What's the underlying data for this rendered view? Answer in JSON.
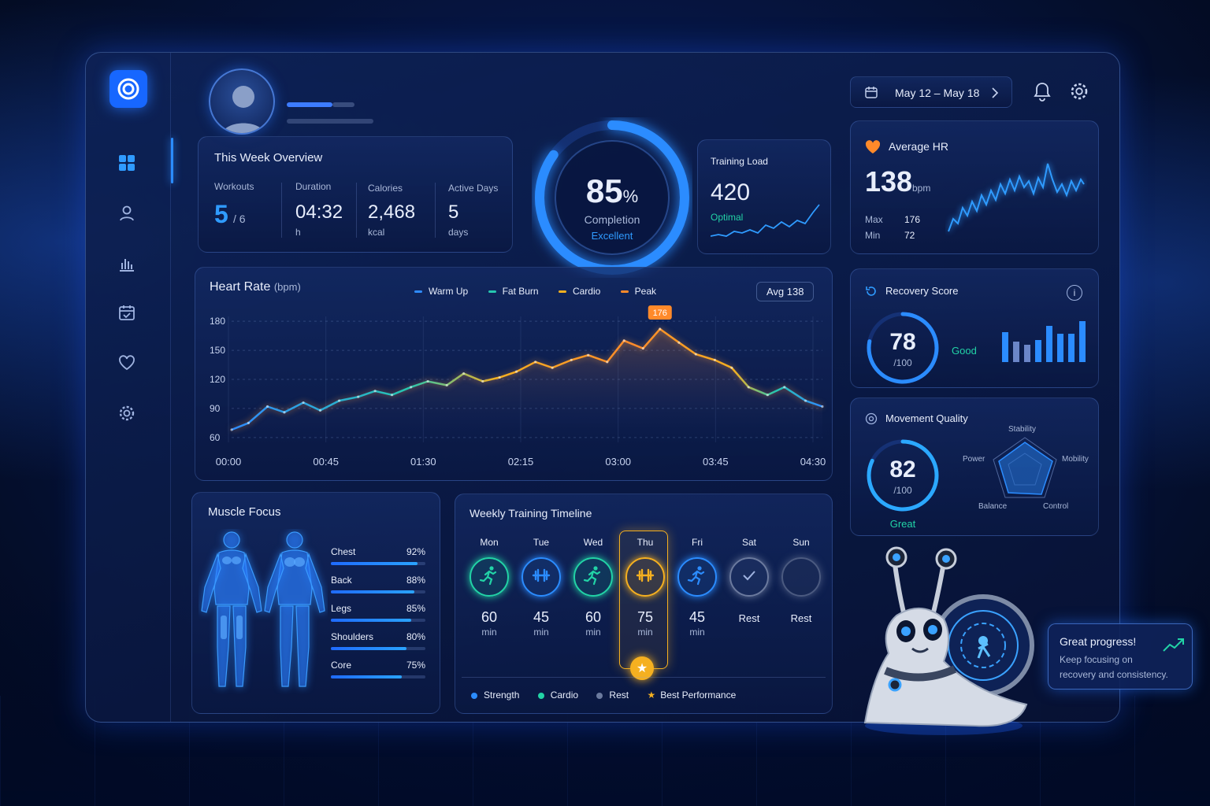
{
  "header": {
    "date_range": "May 12 – May 18"
  },
  "overview": {
    "title": "This Week Overview",
    "stats": [
      {
        "label": "Workouts",
        "value": "5",
        "sub": "/ 6"
      },
      {
        "label": "Duration",
        "value": "04:32",
        "sub": "h"
      },
      {
        "label": "Calories",
        "value": "2,468",
        "sub": "kcal"
      },
      {
        "label": "Active Days",
        "value": "5",
        "sub": "days"
      }
    ]
  },
  "completion": {
    "value": "85",
    "unit": "%",
    "label": "Completion",
    "status": "Excellent",
    "percent": 85
  },
  "training_load": {
    "label": "Training Load",
    "value": "420",
    "status": "Optimal"
  },
  "avg_hr": {
    "title": "Average HR",
    "value": "138",
    "unit": "bpm",
    "max_label": "Max",
    "max": "176",
    "min_label": "Min",
    "min": "72"
  },
  "recovery": {
    "title": "Recovery Score",
    "value": "78",
    "denominator": "/100",
    "status": "Good",
    "percent": 78
  },
  "movement": {
    "title": "Movement Quality",
    "value": "82",
    "denominator": "/100",
    "status": "Great",
    "percent": 82,
    "axes": [
      "Stability",
      "Mobility",
      "Control",
      "Balance",
      "Power"
    ]
  },
  "heart_rate": {
    "title": "Heart Rate",
    "unit": "(bpm)",
    "avg_badge": "Avg 138",
    "legend": [
      {
        "name": "Warm Up",
        "color": "#2f8bff"
      },
      {
        "name": "Fat Burn",
        "color": "#26c6b0"
      },
      {
        "name": "Cardio",
        "color": "#f5b020"
      },
      {
        "name": "Peak",
        "color": "#ff8a2a"
      }
    ],
    "peak_label": "176"
  },
  "chart_data": {
    "type": "line",
    "title": "Heart Rate (bpm)",
    "xlabel": "",
    "ylabel": "",
    "x_ticks": [
      "00:00",
      "00:45",
      "01:30",
      "02:15",
      "03:00",
      "03:45",
      "04:30"
    ],
    "y_ticks": [
      180,
      150,
      120,
      90,
      60
    ],
    "ylim": [
      55,
      185
    ],
    "grid": true,
    "x_minutes": [
      0,
      8,
      17,
      25,
      34,
      42,
      51,
      60,
      68,
      76,
      85,
      93,
      102,
      110,
      119,
      127,
      135,
      144,
      152,
      161,
      169,
      178,
      186,
      195,
      203,
      212,
      220,
      229,
      237,
      245,
      254,
      262,
      272,
      280
    ],
    "values": [
      68,
      75,
      92,
      86,
      96,
      88,
      98,
      102,
      108,
      104,
      112,
      118,
      114,
      126,
      118,
      122,
      128,
      138,
      132,
      140,
      145,
      138,
      160,
      152,
      172,
      158,
      146,
      140,
      132,
      112,
      104,
      112,
      98,
      92
    ]
  },
  "muscle_focus": {
    "title": "Muscle Focus",
    "items": [
      {
        "name": "Chest",
        "pct": "92%",
        "value": 92
      },
      {
        "name": "Back",
        "pct": "88%",
        "value": 88
      },
      {
        "name": "Legs",
        "pct": "85%",
        "value": 85
      },
      {
        "name": "Shoulders",
        "pct": "80%",
        "value": 80
      },
      {
        "name": "Core",
        "pct": "75%",
        "value": 75
      }
    ]
  },
  "timeline": {
    "title": "Weekly Training Timeline",
    "days": [
      {
        "day": "Mon",
        "value": "60",
        "unit": "min",
        "type": "cardio"
      },
      {
        "day": "Tue",
        "value": "45",
        "unit": "min",
        "type": "strength"
      },
      {
        "day": "Wed",
        "value": "60",
        "unit": "min",
        "type": "cardio"
      },
      {
        "day": "Thu",
        "value": "75",
        "unit": "min",
        "type": "best"
      },
      {
        "day": "Fri",
        "value": "45",
        "unit": "min",
        "type": "strength-run"
      },
      {
        "day": "Sat",
        "value": "Rest",
        "unit": "",
        "type": "rest-done"
      },
      {
        "day": "Sun",
        "value": "Rest",
        "unit": "",
        "type": "rest"
      }
    ],
    "legend": [
      "Strength",
      "Cardio",
      "Rest",
      "Best Performance"
    ]
  },
  "mascot": {
    "title": "Great progress!",
    "message_line1": "Keep focusing on",
    "message_line2": "recovery and consistency."
  },
  "colors": {
    "accent": "#2f9bff",
    "orange": "#ff8a2a",
    "green": "#22d3a6",
    "gold": "#f5b020"
  }
}
